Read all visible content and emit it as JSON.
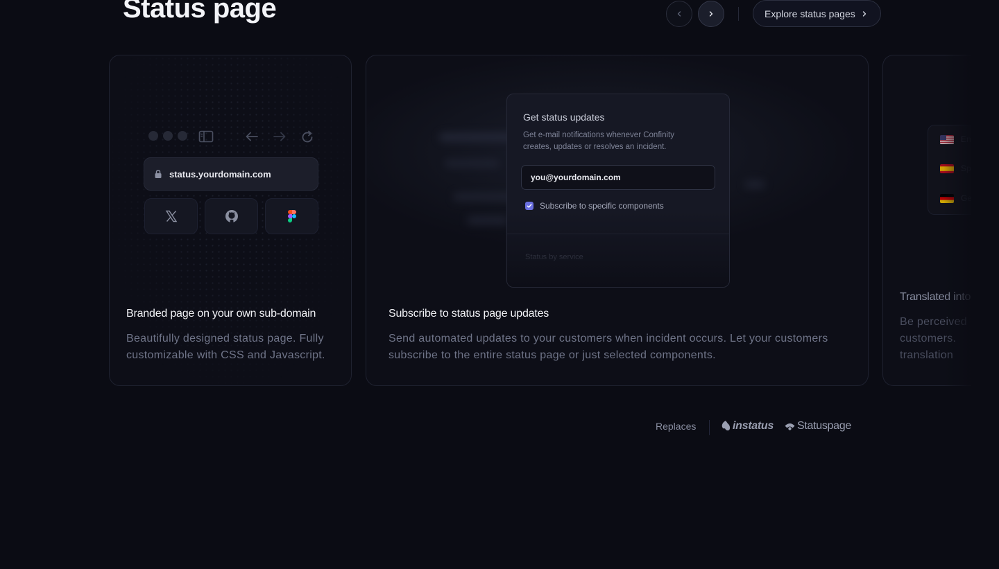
{
  "header": {
    "title": "Status page",
    "prev_icon": "chevron-left-icon",
    "next_icon": "chevron-right-icon",
    "explore_label": "Explore status pages"
  },
  "cards": [
    {
      "title": "Branded page on your own sub-domain",
      "description": "Beautifully designed status page. Fully customizable with CSS and Javascript.",
      "url": "status.yourdomain.com",
      "social_icons": [
        "x-icon",
        "github-icon",
        "figma-icon"
      ]
    },
    {
      "title": "Subscribe to status page updates",
      "description": "Send automated updates to your customers when incident occurs. Let your customers subscribe to the entire status page or just selected components.",
      "panel": {
        "title": "Get status updates",
        "description": "Get e-mail notifications whenever Confinity creates, updates or resolves an incident.",
        "email_value": "you@yourdomain.com",
        "checkbox_label": "Subscribe to specific components",
        "checkbox_checked": true,
        "section_label": "Status by service"
      }
    },
    {
      "title": "Translated into",
      "description": "Be perceived customers. translation",
      "languages": [
        "En",
        "Sp",
        "Ge"
      ]
    }
  ],
  "replaces": {
    "label": "Replaces",
    "logos": [
      "instatus",
      "Statuspage"
    ]
  },
  "colors": {
    "background": "#0b0c14",
    "card_border": "#1f2230",
    "accent_checkbox": "#6a6fe0"
  }
}
